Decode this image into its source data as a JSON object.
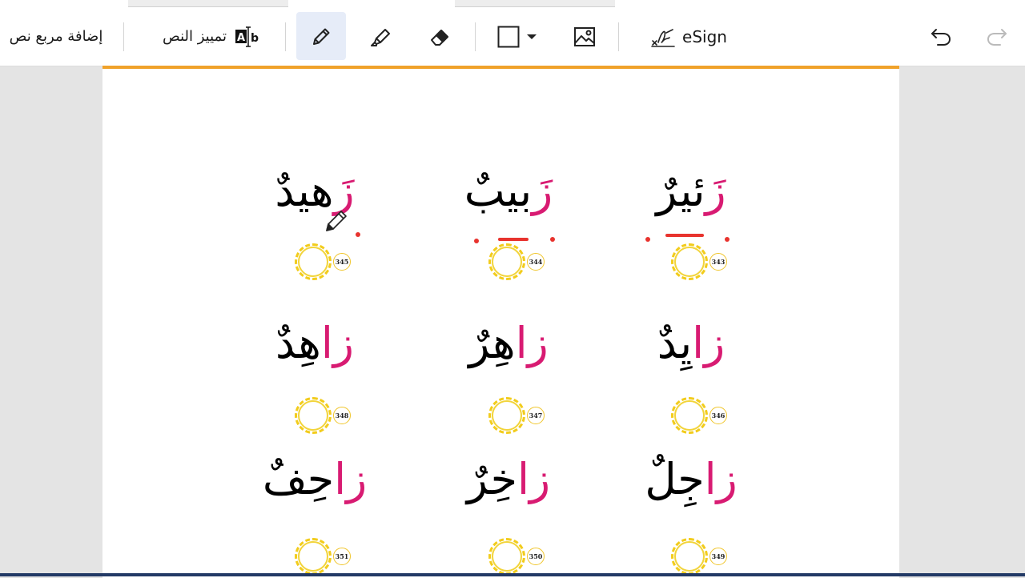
{
  "toolbar": {
    "add_textbox_label": "إضافة مربع نص",
    "highlight_text_label": "تمييز النص",
    "esign_label": "eSign",
    "icons": {
      "add_textbox": "textbox-icon",
      "highlight_text": "text-highlight-icon",
      "pen": "pencil-icon",
      "highlighter": "highlighter-icon",
      "eraser": "eraser-icon",
      "shape": "rectangle-icon",
      "image": "image-icon",
      "esign": "signature-icon",
      "undo": "undo-icon",
      "redo": "redo-icon"
    },
    "active_tool": "pen"
  },
  "colors": {
    "accent_border": "#f0a22a",
    "letter_highlight": "#d81b72",
    "annotation": "#e8332e",
    "audio_ring": "#f2cc1c"
  },
  "words": [
    {
      "lead": "زَ",
      "rest": "ئيرٌ",
      "number": "343"
    },
    {
      "lead": "زَ",
      "rest": "بيبٌ",
      "number": "344"
    },
    {
      "lead": "زَ",
      "rest": "هيدٌ",
      "number": "345"
    },
    {
      "lead": "زا",
      "rest": "يِدٌ",
      "number": "346"
    },
    {
      "lead": "زا",
      "rest": "هِرٌ",
      "number": "347"
    },
    {
      "lead": "زا",
      "rest": "هِدٌ",
      "number": "348"
    },
    {
      "lead": "زا",
      "rest": "جِلٌ",
      "number": "349"
    },
    {
      "lead": "زا",
      "rest": "خِرٌ",
      "number": "350"
    },
    {
      "lead": "زا",
      "rest": "حِفٌ",
      "number": "351"
    }
  ]
}
